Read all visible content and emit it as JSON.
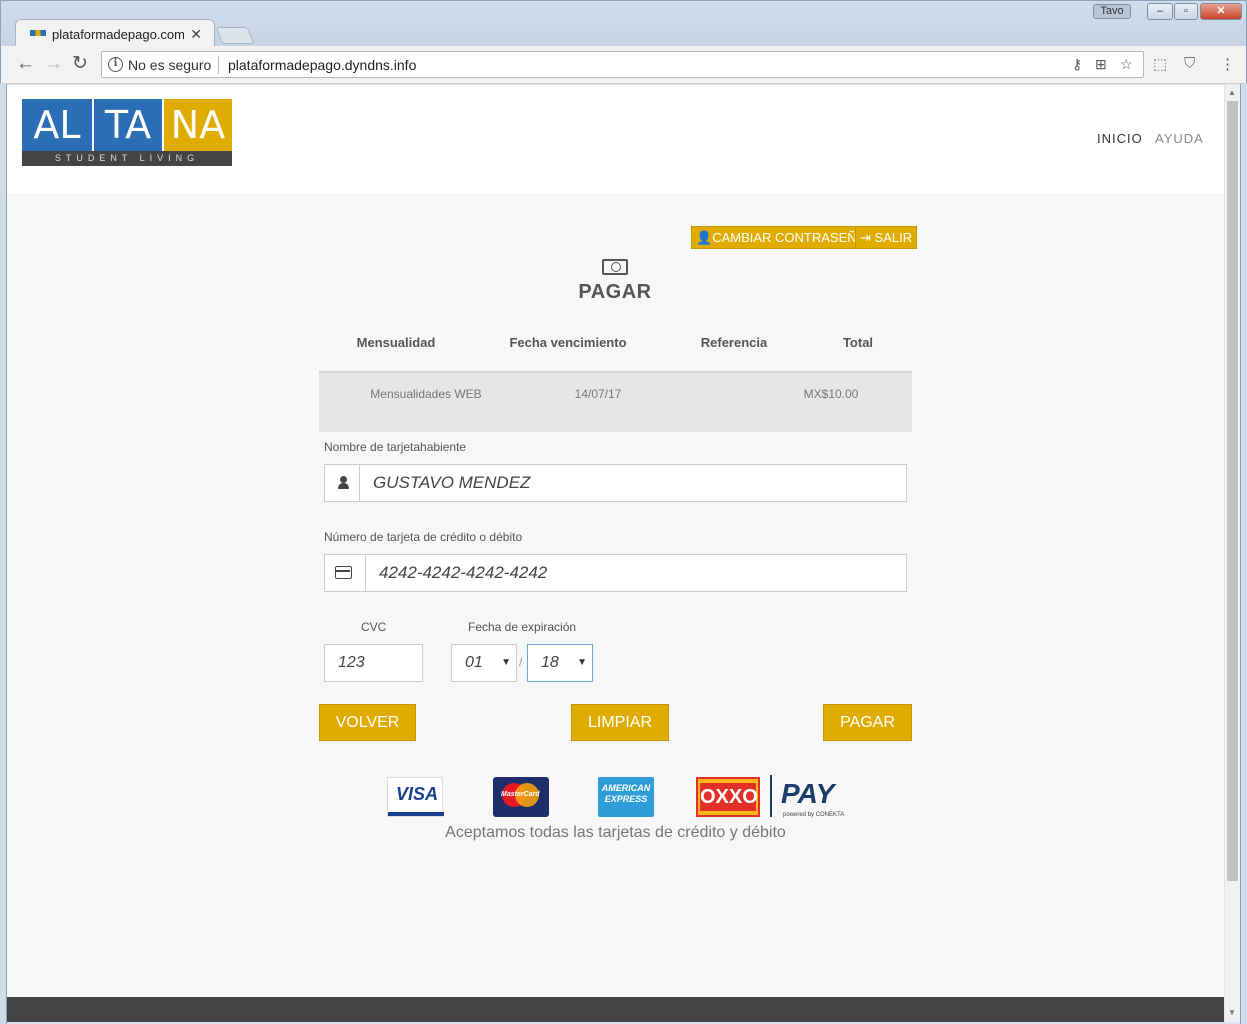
{
  "browser": {
    "tab_title": "plataformadepago.com.mx",
    "tab_close": "✕",
    "user_badge": "Tavo",
    "security_label": "No es seguro",
    "url": "plataformadepago.dyndns.info",
    "window_controls": [
      "–",
      "▫",
      "✕"
    ]
  },
  "site": {
    "logo": {
      "blocks": [
        "AL",
        "TA",
        "NA"
      ],
      "tagline": "STUDENT LIVING",
      "colors": [
        "#2a6fb5",
        "#2a6fb5",
        "#e1ac00"
      ]
    },
    "nav": {
      "inicio": "INICIO",
      "ayuda": "AYUDA"
    }
  },
  "account_actions": {
    "change_password": "CAMBIAR CONTRASEÑA",
    "logout": "SALIR"
  },
  "page_title": "PAGAR",
  "table": {
    "headers": [
      "Mensualidad",
      "Fecha vencimiento",
      "Referencia",
      "Total"
    ],
    "rows": [
      {
        "mensualidad": "Mensualidades WEB",
        "fecha": "14/07/17",
        "referencia": "",
        "total": "MX$10.00"
      }
    ]
  },
  "form": {
    "cardholder_label": "Nombre de tarjetahabiente",
    "cardholder_value": "GUSTAVO MENDEZ",
    "card_number_label": "Número de tarjeta de crédito o débito",
    "card_number_value": "4242-4242-4242-4242",
    "cvc_label": "CVC",
    "cvc_value": "123",
    "expiry_label": "Fecha de expiración",
    "expiry_month": "01",
    "expiry_year": "18",
    "expiry_separator": "/"
  },
  "buttons": {
    "back": "VOLVER",
    "clear": "LIMPIAR",
    "pay": "PAGAR"
  },
  "payment_methods": {
    "visa": "VISA",
    "mastercard": "MasterCard",
    "amex": "AMERICAN EXPRESS",
    "oxxo": "OXXO",
    "pay": "PAY",
    "pay_sub": "powered by CONEKTA",
    "accept_text": "Aceptamos todas las tarjetas de crédito y débito"
  },
  "theme": {
    "accent": "#e1ac00",
    "brand_blue": "#2a6fb5"
  }
}
